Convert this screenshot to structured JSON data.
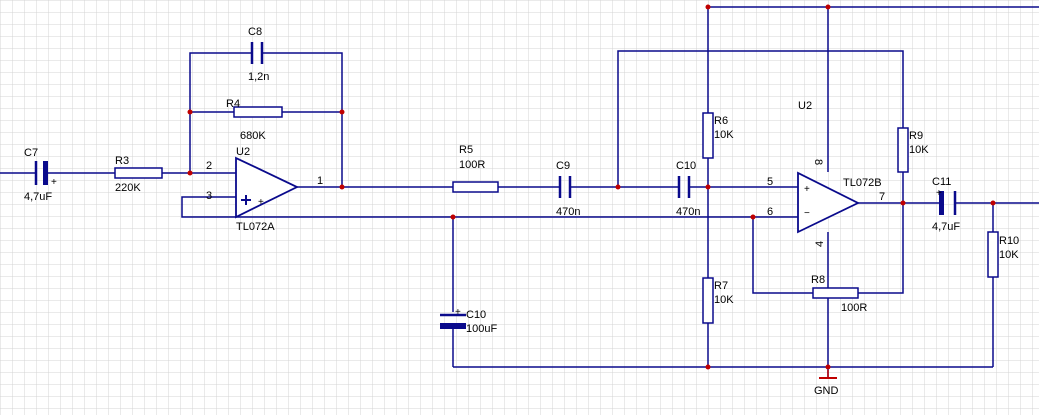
{
  "components": {
    "c7": {
      "ref": "C7",
      "value": "4,7uF"
    },
    "r3": {
      "ref": "R3",
      "value": "220K"
    },
    "c8": {
      "ref": "C8",
      "value": "1,2n"
    },
    "r4": {
      "ref": "R4",
      "value": "680K"
    },
    "u2a": {
      "ref": "U2",
      "part": "TL072A"
    },
    "r5": {
      "ref": "R5",
      "value": "100R"
    },
    "c9": {
      "ref": "C9",
      "value": "470n"
    },
    "c10a": {
      "ref": "C10",
      "value": "470n"
    },
    "c10b": {
      "ref": "C10",
      "value": "100uF"
    },
    "r6": {
      "ref": "R6",
      "value": "10K"
    },
    "r7": {
      "ref": "R7",
      "value": "10K"
    },
    "u2b": {
      "ref": "U2",
      "part": "TL072B"
    },
    "r8": {
      "ref": "R8",
      "value": "100R"
    },
    "r9": {
      "ref": "R9",
      "value": "10K"
    },
    "c11": {
      "ref": "C11",
      "value": "4,7uF"
    },
    "r10": {
      "ref": "R10",
      "value": "10K"
    }
  },
  "pins": {
    "u2a_in_inv": "2",
    "u2a_in_noninv": "3",
    "u2a_out": "1",
    "u2b_in_noninv": "5",
    "u2b_in_inv": "6",
    "u2b_out": "7",
    "u2b_vplus": "8",
    "u2b_vminus": "4"
  },
  "symbols": {
    "plus": "+",
    "minus": "−"
  },
  "power": {
    "gnd": "GND"
  },
  "colors": {
    "wire": "#0a0a8c",
    "junction": "#c00000",
    "grid": "#d4d4d4",
    "ground": "#c00000"
  }
}
